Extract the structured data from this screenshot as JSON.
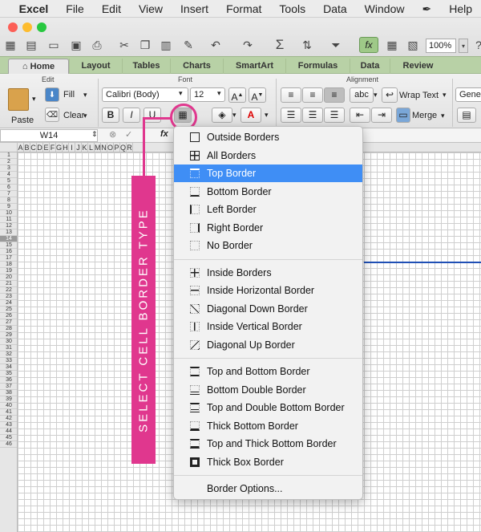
{
  "menubar": {
    "app": "Excel",
    "items": [
      "File",
      "Edit",
      "View",
      "Insert",
      "Format",
      "Tools",
      "Data",
      "Window",
      "Help"
    ]
  },
  "toolbar": {
    "zoom": "100%",
    "fx": "fx"
  },
  "tabs": [
    "Home",
    "Layout",
    "Tables",
    "Charts",
    "SmartArt",
    "Formulas",
    "Data",
    "Review"
  ],
  "ribbon": {
    "groups": {
      "edit": "Edit",
      "font": "Font",
      "alignment": "Alignment"
    },
    "paste": "Paste",
    "fill": "Fill",
    "clear": "Clear",
    "font_name": "Calibri (Body)",
    "font_size": "12",
    "bold": "B",
    "italic": "I",
    "underline": "U",
    "wrap_text": "Wrap Text",
    "merge": "Merge",
    "number_format": "Gener",
    "abc": "abc"
  },
  "formula_bar": {
    "name_box": "W14",
    "fx": "fx"
  },
  "columns": [
    "A",
    "B",
    "C",
    "D",
    "E",
    "F",
    "G",
    "H",
    "I",
    "J",
    "K",
    "L",
    "M",
    "N",
    "O",
    "P",
    "Q",
    "R"
  ],
  "rows": [
    "1",
    "2",
    "3",
    "4",
    "5",
    "6",
    "7",
    "8",
    "9",
    "10",
    "11",
    "12",
    "13",
    "14",
    "15",
    "16",
    "17",
    "18",
    "19",
    "20",
    "21",
    "22",
    "23",
    "24",
    "25",
    "26",
    "27",
    "28",
    "29",
    "30",
    "31",
    "32",
    "33",
    "34",
    "35",
    "36",
    "37",
    "38",
    "39",
    "40",
    "41",
    "42",
    "43",
    "44",
    "45",
    "46"
  ],
  "selected_row": "14",
  "callout": "SELECT CELL BORDER TYPE",
  "border_menu": {
    "group1": [
      {
        "label": "Outside Borders",
        "icon": "outside-borders-icon"
      },
      {
        "label": "All Borders",
        "icon": "all-borders-icon"
      },
      {
        "label": "Top Border",
        "icon": "top-border-icon",
        "highlighted": true
      },
      {
        "label": "Bottom Border",
        "icon": "bottom-border-icon"
      },
      {
        "label": "Left Border",
        "icon": "left-border-icon"
      },
      {
        "label": "Right Border",
        "icon": "right-border-icon"
      },
      {
        "label": "No Border",
        "icon": "no-border-icon"
      }
    ],
    "group2": [
      {
        "label": "Inside Borders",
        "icon": "inside-borders-icon"
      },
      {
        "label": "Inside Horizontal Border",
        "icon": "inside-horizontal-border-icon"
      },
      {
        "label": "Diagonal Down Border",
        "icon": "diagonal-down-border-icon"
      },
      {
        "label": "Inside Vertical Border",
        "icon": "inside-vertical-border-icon"
      },
      {
        "label": "Diagonal Up Border",
        "icon": "diagonal-up-border-icon"
      }
    ],
    "group3": [
      {
        "label": "Top and Bottom Border",
        "icon": "top-bottom-border-icon"
      },
      {
        "label": "Bottom Double Border",
        "icon": "bottom-double-border-icon"
      },
      {
        "label": "Top and Double Bottom Border",
        "icon": "top-double-bottom-border-icon"
      },
      {
        "label": "Thick Bottom Border",
        "icon": "thick-bottom-border-icon"
      },
      {
        "label": "Top and Thick Bottom Border",
        "icon": "top-thick-bottom-border-icon"
      },
      {
        "label": "Thick Box Border",
        "icon": "thick-box-border-icon"
      }
    ],
    "options": "Border Options..."
  },
  "colors": {
    "highlight": "#3f8ef5",
    "callout": "#e0378e",
    "ribbon_tabs": "#b8d1a6",
    "border_line": "#1f4fb5"
  }
}
